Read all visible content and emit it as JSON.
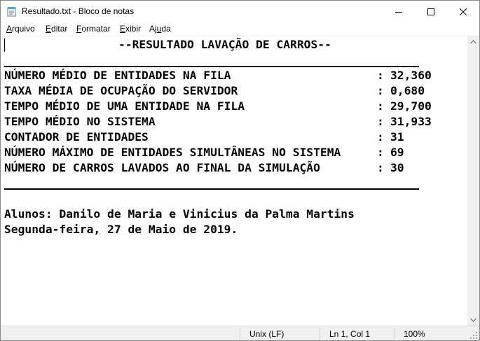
{
  "window": {
    "title": "Resultado.txt - Bloco de notas",
    "app_icon": "notepad-icon",
    "controls": [
      "minimize-icon",
      "maximize-icon",
      "close-icon"
    ]
  },
  "menubar": {
    "items": [
      {
        "pre": "",
        "acc": "A",
        "post": "rquivo"
      },
      {
        "pre": "",
        "acc": "E",
        "post": "ditar"
      },
      {
        "pre": "",
        "acc": "F",
        "post": "ormatar"
      },
      {
        "pre": "",
        "acc": "E",
        "post": "xibir"
      },
      {
        "pre": "Aj",
        "acc": "u",
        "post": "da"
      }
    ]
  },
  "document": {
    "heading": "--RESULTADO LAVAÇÃO DE CARROS--",
    "rows": [
      {
        "label": "NÚMERO MÉDIO DE ENTIDADES NA FILA",
        "value": "32,360"
      },
      {
        "label": "TAXA MÉDIA DE OCUPAÇÃO DO SERVIDOR",
        "value": "0,680"
      },
      {
        "label": "TEMPO MÉDIO DE UMA ENTIDADE NA FILA",
        "value": "29,700"
      },
      {
        "label": "TEMPO MÉDIO NO SISTEMA",
        "value": "31,933"
      },
      {
        "label": "CONTADOR DE ENTIDADES",
        "value": "31"
      },
      {
        "label": "NÚMERO MÁXIMO DE ENTIDADES SIMULTÂNEAS NO SISTEMA",
        "value": "69"
      },
      {
        "label": "NÚMERO DE CARROS LAVADOS AO FINAL DA SIMULAÇÃO",
        "value": "30"
      }
    ],
    "separator": ":",
    "authors": "Alunos: Danilo de Maria e Vinicius da Palma Martins",
    "date": "Segunda-feira, 27 de Maio de 2019."
  },
  "statusbar": {
    "encoding": "Unix (LF)",
    "position": "Ln 1, Col 1",
    "zoom": "100%"
  }
}
